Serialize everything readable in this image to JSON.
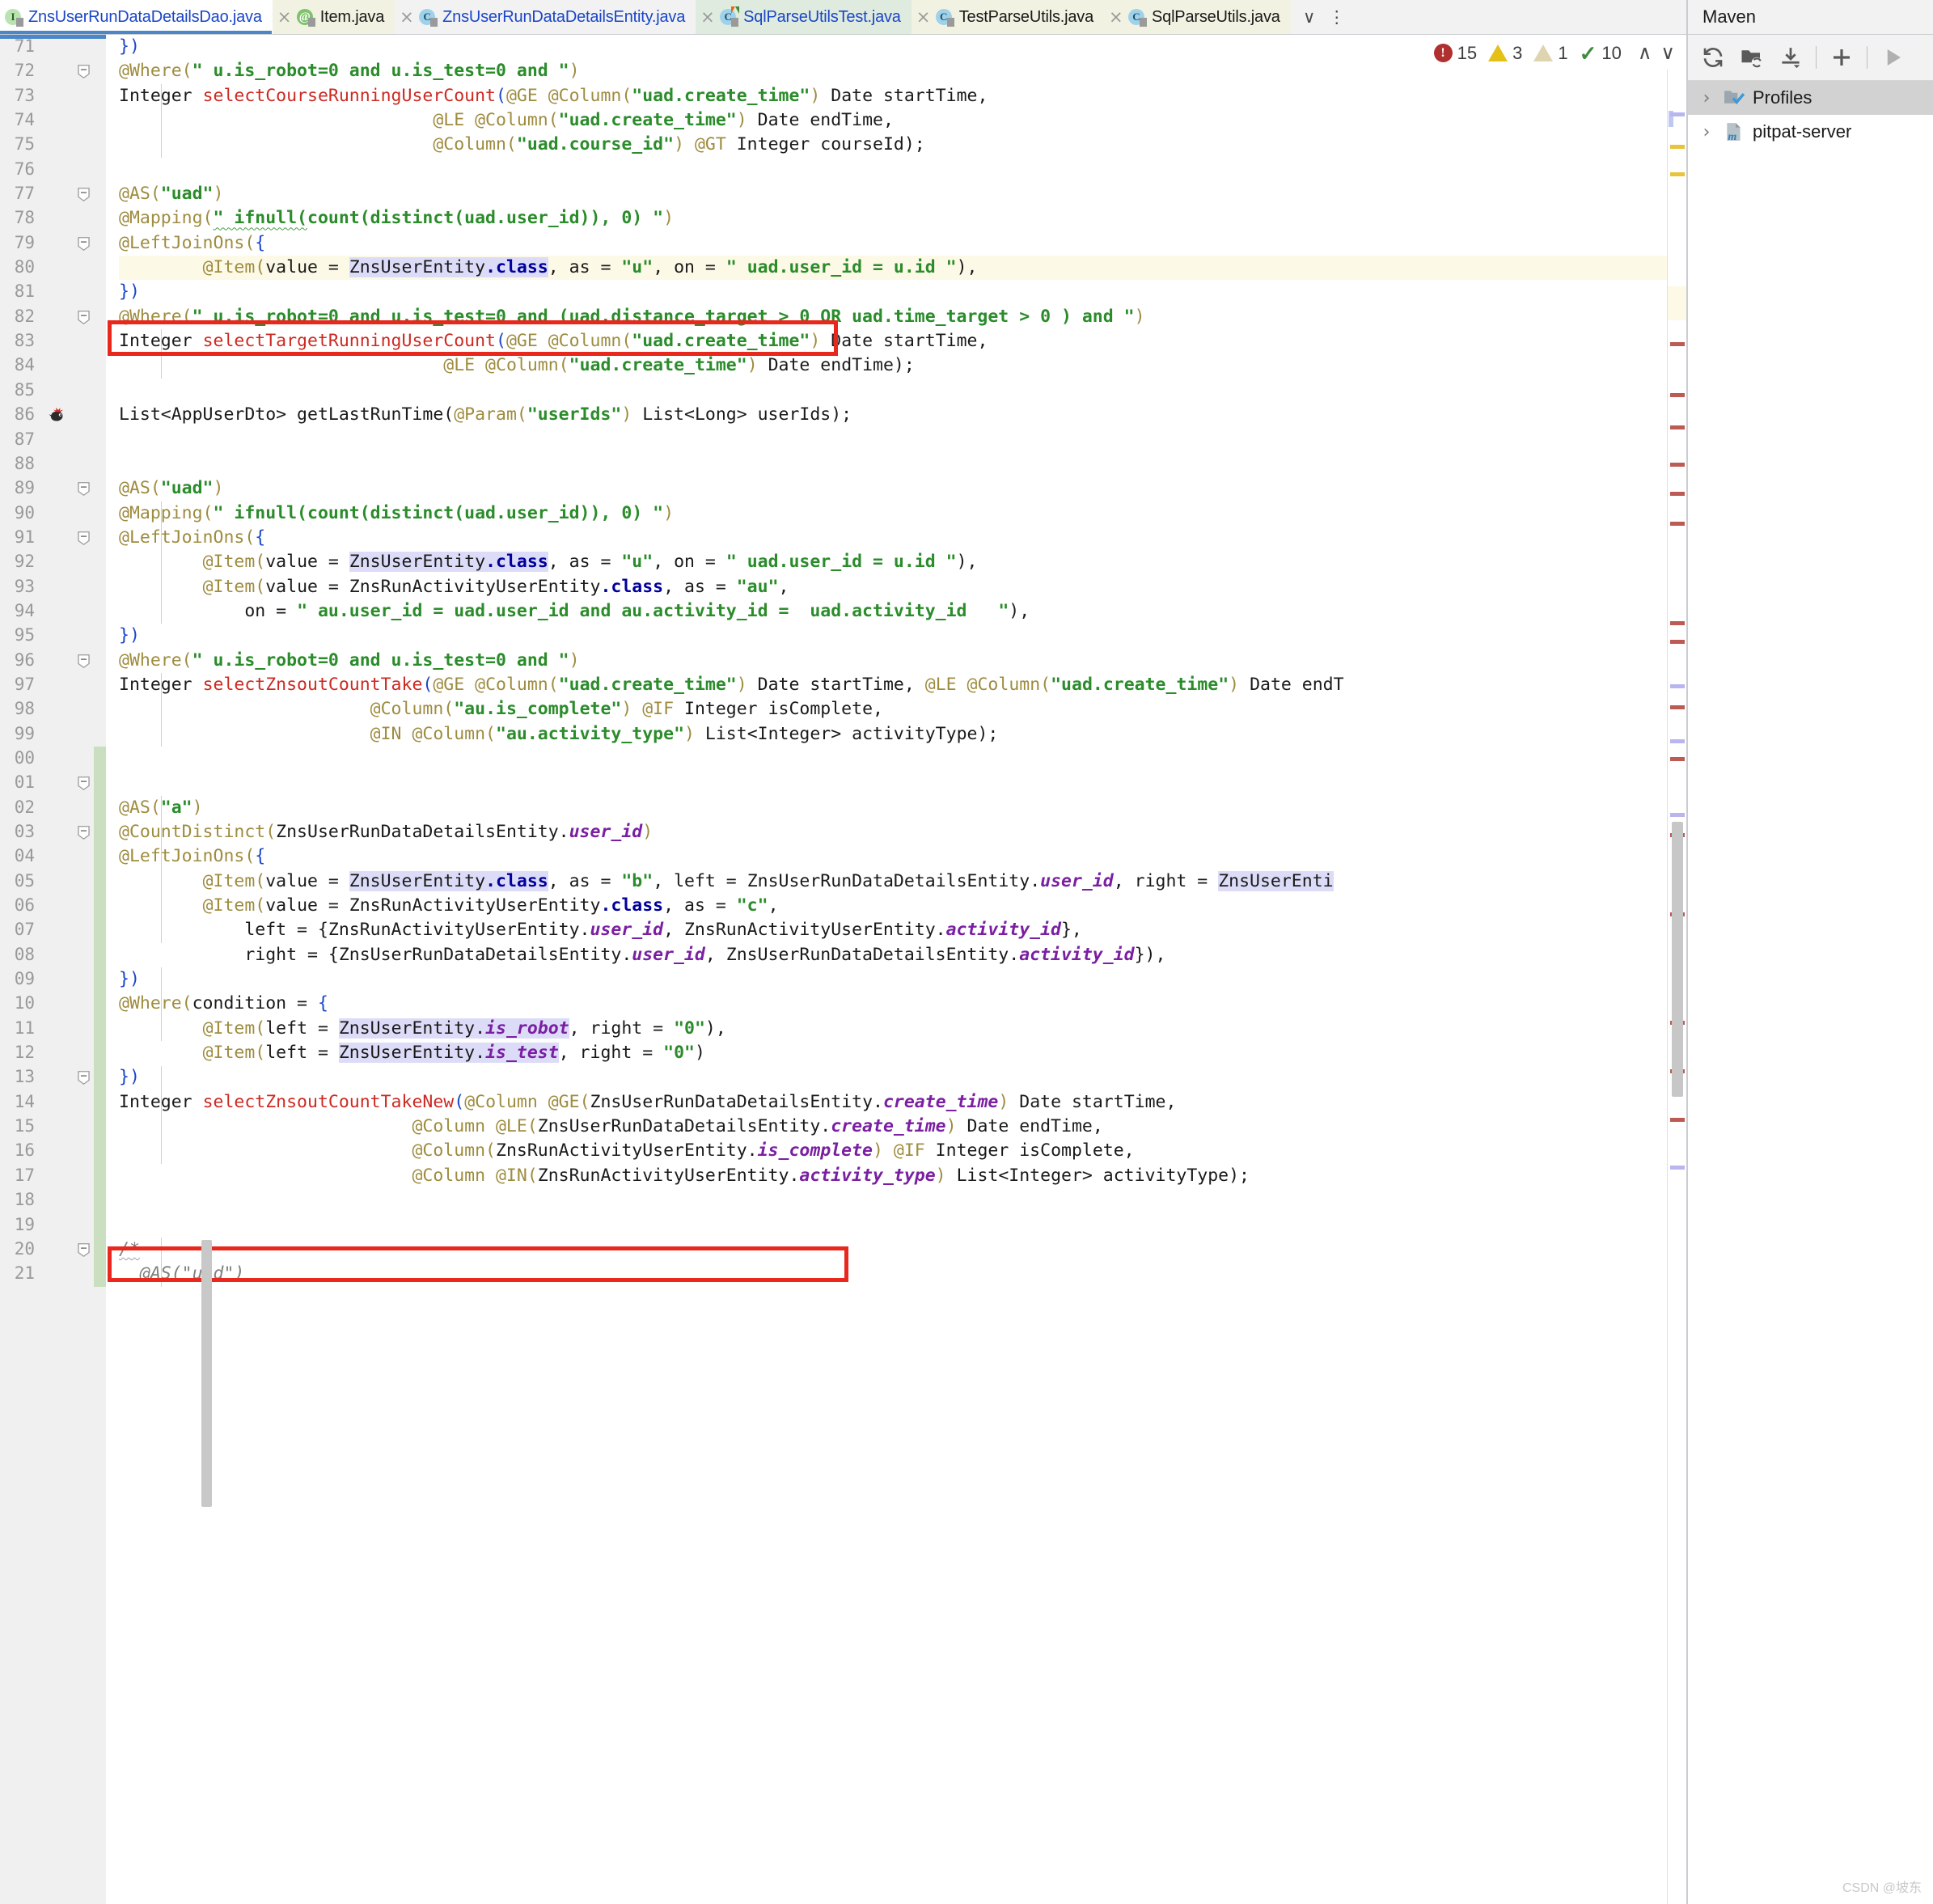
{
  "window": {
    "watermark": "CSDN @坡东"
  },
  "tabbar": {
    "tabs": [
      {
        "label": "ZnsUserRunDataDetailsDao.java",
        "icon": "interface-file-icon",
        "active": true,
        "tint": "white",
        "labelColor": "blue",
        "close": "×"
      },
      {
        "label": "Item.java",
        "icon": "annotation-file-icon",
        "active": false,
        "tint": "yellow",
        "labelColor": "black",
        "close": "×"
      },
      {
        "label": "ZnsUserRunDataDetailsEntity.java",
        "icon": "class-file-icon",
        "active": false,
        "tint": "grey",
        "labelColor": "blue",
        "close": "×"
      },
      {
        "label": "SqlParseUtilsTest.java",
        "icon": "class-run-file-icon",
        "active": false,
        "tint": "green",
        "labelColor": "blue",
        "close": "×"
      },
      {
        "label": "TestParseUtils.java",
        "icon": "class-file-icon",
        "active": false,
        "tint": "yellow",
        "labelColor": "black",
        "close": "×"
      },
      {
        "label": "SqlParseUtils.java",
        "icon": "class-file-icon",
        "active": false,
        "tint": "yellow",
        "labelColor": "black",
        "close": "×"
      }
    ],
    "overflow_chevron": "∨",
    "more_menu": "⋮"
  },
  "inspections": {
    "errors": "15",
    "warnings": "3",
    "weak_warnings": "1",
    "ok_count": "10",
    "prev_label": "∧",
    "next_label": "∨"
  },
  "editor": {
    "first_line_number": 71,
    "gutter_numbers": [
      "71",
      "72",
      "73",
      "74",
      "75",
      "76",
      "77",
      "78",
      "79",
      "80",
      "81",
      "82",
      "83",
      "84",
      "85",
      "86",
      "87",
      "88",
      "89",
      "90",
      "91",
      "92",
      "93",
      "94",
      "95",
      "96",
      "97",
      "98",
      "99",
      "00",
      "01",
      "02",
      "03",
      "04",
      "05",
      "06",
      "07",
      "08",
      "09",
      "10",
      "11",
      "12",
      "13",
      "14",
      "15",
      "16",
      "17",
      "18",
      "19",
      "20",
      "21"
    ],
    "caret_line_index": 9,
    "lines": [
      "})",
      "@Where(\" u.is_robot=0 and u.is_test=0 and \")",
      "Integer selectCourseRunningUserCount(@GE @Column(\"uad.create_time\") Date startTime,",
      "                              @LE @Column(\"uad.create_time\") Date endTime,",
      "                              @Column(\"uad.course_id\") @GT Integer courseId);",
      "",
      "@AS(\"uad\")",
      "@Mapping(\" ifnull(count(distinct(uad.user_id)), 0) \")",
      "@LeftJoinOns({",
      "        @Item(value = ZnsUserEntity.class, as = \"u\", on = \" uad.user_id = u.id \"),",
      "})",
      "@Where(\" u.is_robot=0 and u.is_test=0 and (uad.distance_target > 0 OR uad.time_target > 0 ) and \")",
      "Integer selectTargetRunningUserCount(@GE @Column(\"uad.create_time\") Date startTime,",
      "                               @LE @Column(\"uad.create_time\") Date endTime);",
      "",
      "List<AppUserDto> getLastRunTime(@Param(\"userIds\") List<Long> userIds);",
      "",
      "",
      "@AS(\"uad\")",
      "@Mapping(\" ifnull(count(distinct(uad.user_id)), 0) \")",
      "@LeftJoinOns({",
      "        @Item(value = ZnsUserEntity.class, as = \"u\", on = \" uad.user_id = u.id \"),",
      "        @Item(value = ZnsRunActivityUserEntity.class, as = \"au\",",
      "            on = \" au.user_id = uad.user_id and au.activity_id =  uad.activity_id   \"),",
      "})",
      "@Where(\" u.is_robot=0 and u.is_test=0 and \")",
      "Integer selectZnsoutCountTake(@GE @Column(\"uad.create_time\") Date startTime, @LE @Column(\"uad.create_time\") Date endT",
      "                        @Column(\"au.is_complete\") @IF Integer isComplete,",
      "                        @IN @Column(\"au.activity_type\") List<Integer> activityType);",
      "",
      "",
      "@AS(\"a\")",
      "@CountDistinct(ZnsUserRunDataDetailsEntity.user_id)",
      "@LeftJoinOns({",
      "        @Item(value = ZnsUserEntity.class, as = \"b\", left = ZnsUserRunDataDetailsEntity.user_id, right = ZnsUserEnti",
      "        @Item(value = ZnsRunActivityUserEntity.class, as = \"c\",",
      "            left = {ZnsRunActivityUserEntity.user_id, ZnsRunActivityUserEntity.activity_id},",
      "            right = {ZnsUserRunDataDetailsEntity.user_id, ZnsUserRunDataDetailsEntity.activity_id}),",
      "})",
      "@Where(condition = {",
      "        @Item(left = ZnsUserEntity.is_robot, right = \"0\"),",
      "        @Item(left = ZnsUserEntity.is_test, right = \"0\")",
      "})",
      "Integer selectZnsoutCountTakeNew(@Column @GE(ZnsUserRunDataDetailsEntity.create_time) Date startTime,",
      "                            @Column @LE(ZnsUserRunDataDetailsEntity.create_time) Date endTime,",
      "                            @Column(ZnsRunActivityUserEntity.is_complete) @IF Integer isComplete,",
      "                            @Column @IN(ZnsRunActivityUserEntity.activity_type) List<Integer> activityType);",
      "",
      "",
      "/*",
      "@AS(\"uad\")"
    ],
    "annotation_boxes": [
      {
        "name": "mapping-highlight-box",
        "line": 78,
        "text": "@Mapping(\" ifnull(count(distinct(uad.user_id)), 0) \")"
      },
      {
        "name": "countdistinct-highlight-box",
        "line": 103,
        "text": "@CountDistinct(ZnsUserRunDataDetailsEntity.user_id)"
      }
    ],
    "colors": {
      "annotation": "#9e8c3f",
      "string": "#2b8c2b",
      "keyword": "#00009b",
      "method": "#cc2a22",
      "field": "#7a1fa2",
      "caret_row": "#fdf9e7",
      "identifier_highlight": "#dcdcf8",
      "redbox": "#e8281c",
      "tab_active_underline": "#4a86c8"
    }
  },
  "maven": {
    "title": "Maven",
    "toolbar": [
      {
        "name": "reload-all-maven-projects-icon",
        "glyph": "refresh"
      },
      {
        "name": "generate-sources-icon",
        "glyph": "folder-refresh"
      },
      {
        "name": "download-sources-icon",
        "glyph": "download"
      },
      {
        "name": "add-maven-project-icon",
        "glyph": "plus"
      },
      {
        "name": "run-maven-goal-icon",
        "glyph": "play"
      }
    ],
    "tree": [
      {
        "label": "Profiles",
        "icon": "profiles-folder-icon",
        "expanded": false,
        "selected": true,
        "chevron": "›"
      },
      {
        "label": "pitpat-server",
        "icon": "maven-module-icon",
        "expanded": false,
        "selected": false,
        "chevron": "›"
      }
    ]
  }
}
